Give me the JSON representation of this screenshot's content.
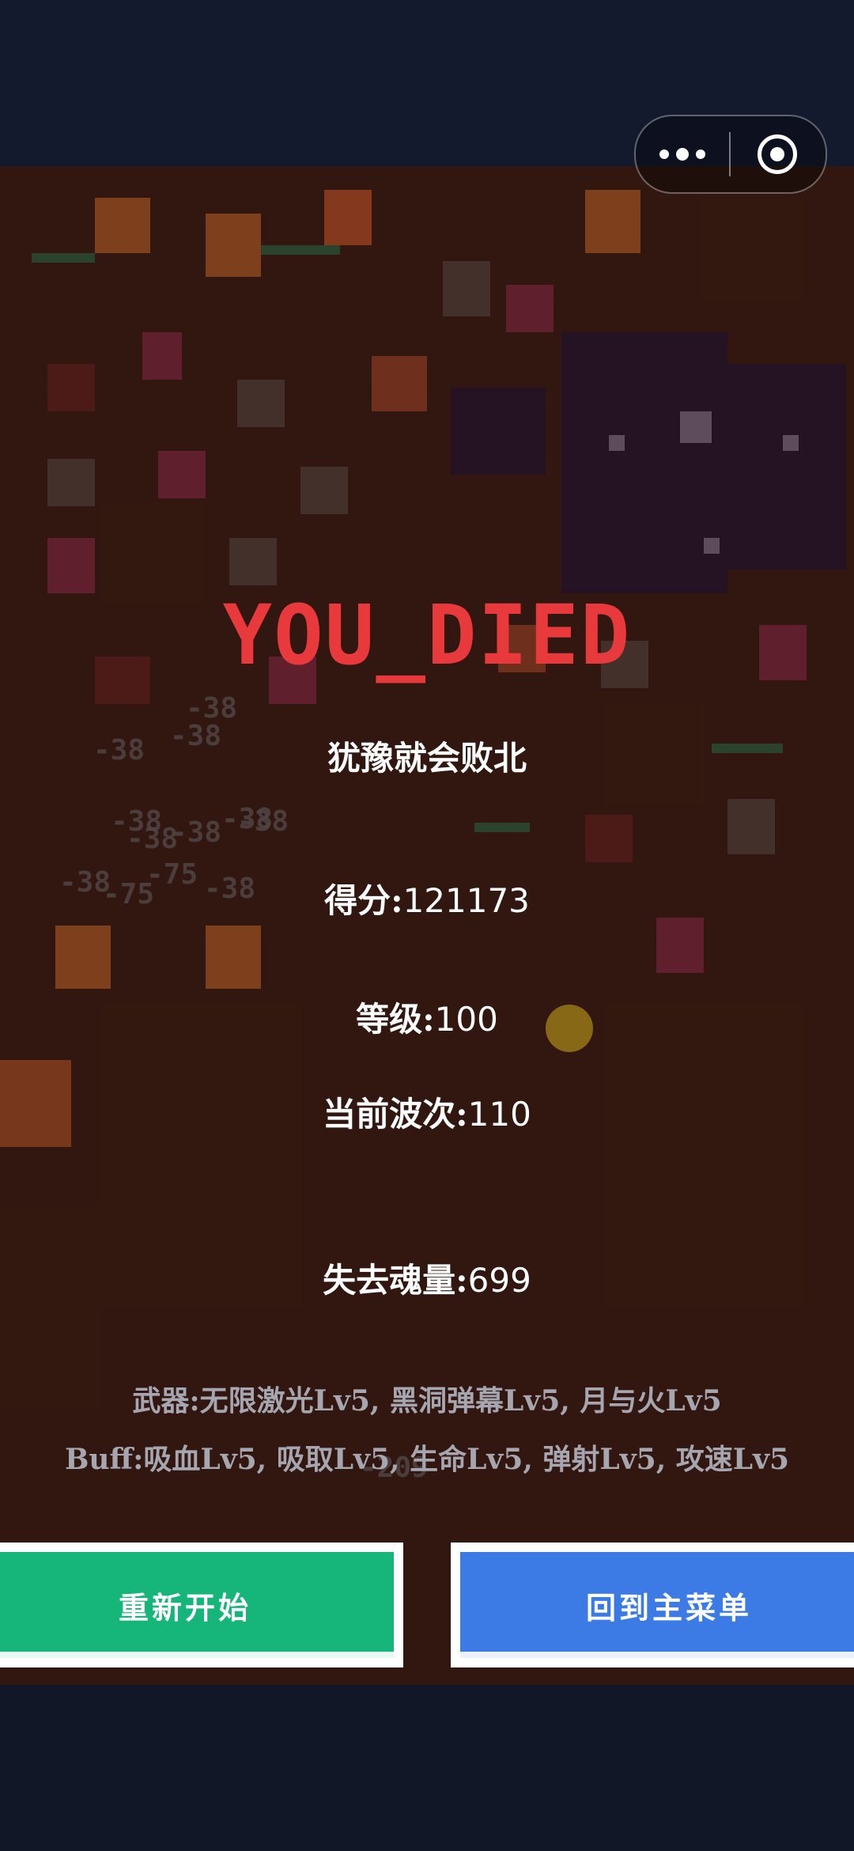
{
  "header": {
    "more_icon": "more-dots-icon",
    "close_icon": "target-circle-icon"
  },
  "background_damage_numbers": [
    "-38",
    "-38",
    "-38",
    "-38",
    "-38",
    "-38",
    "-38",
    "-38",
    "-75",
    "-75",
    "-38",
    "-38",
    "-209"
  ],
  "death_screen": {
    "title": "YOU_DIED",
    "motto": "犹豫就会败北",
    "score_label": "得分:",
    "score_value": "121173",
    "level_label": "等级:",
    "level_value": "100",
    "wave_label": "当前波次:",
    "wave_value": "110",
    "souls_label": "失去魂量:",
    "souls_value": "699",
    "weapons_text": "武器:无限激光Lv5, 黑洞弹幕Lv5, 月与火Lv5",
    "buff_text": "Buff:吸血Lv5, 吸取Lv5, 生命Lv5, 弹射Lv5, 攻速Lv5"
  },
  "buttons": {
    "restart_label": "重新开始",
    "main_menu_label": "回到主菜单"
  },
  "colors": {
    "title": "#e8393d",
    "restart": "#16b57a",
    "menu": "#3c7be6"
  }
}
